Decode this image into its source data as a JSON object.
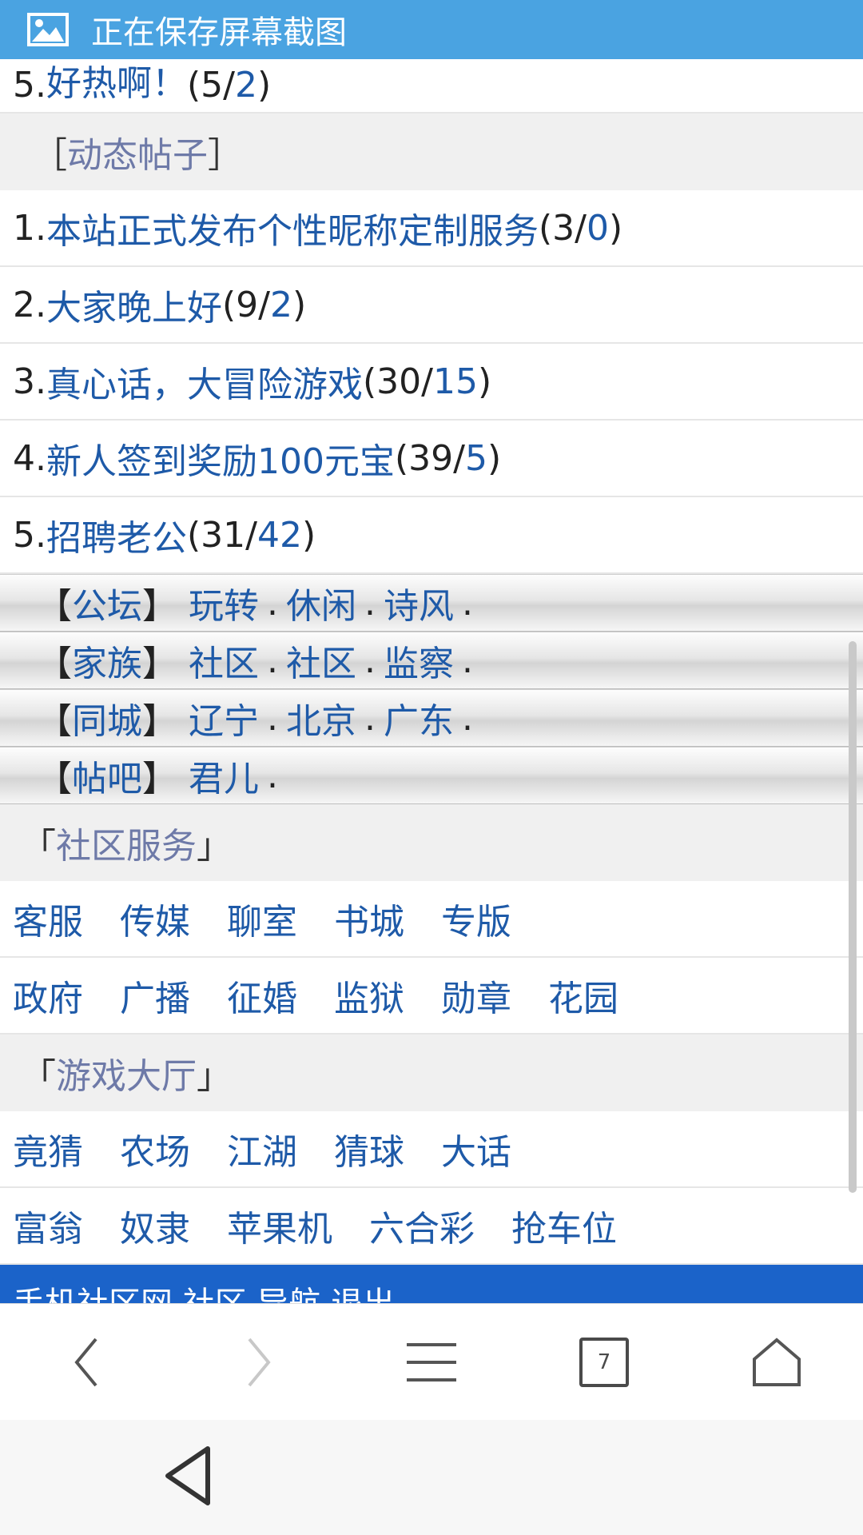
{
  "toast": {
    "icon": "image-icon",
    "text": "正在保存屏幕截图"
  },
  "top_partial_item": {
    "num": "5.",
    "title": "好热啊！",
    "count_a": "5",
    "count_b": "2"
  },
  "dynamic_posts": {
    "header": "动态帖子",
    "items": [
      {
        "num": "1.",
        "title": "本站正式发布个性昵称定制服务",
        "count_a": "3",
        "count_b": "0"
      },
      {
        "num": "2.",
        "title": "大家晚上好",
        "count_a": "9",
        "count_b": "2"
      },
      {
        "num": "3.",
        "title": "真心话，大冒险游戏",
        "count_a": "30",
        "count_b": "15"
      },
      {
        "num": "4.",
        "title": "新人签到奖励100元宝",
        "count_a": "39",
        "count_b": "5"
      },
      {
        "num": "5.",
        "title": "招聘老公",
        "count_a": "31",
        "count_b": "42"
      }
    ]
  },
  "forum_strips": [
    {
      "label": "公坛",
      "links": [
        "玩转",
        "休闲",
        "诗风"
      ]
    },
    {
      "label": "家族",
      "links": [
        "社区",
        "社区",
        "监察"
      ]
    },
    {
      "label": "同城",
      "links": [
        "辽宁",
        "北京",
        "广东"
      ]
    },
    {
      "label": "帖吧",
      "links": [
        "君儿"
      ]
    }
  ],
  "community_services": {
    "header": "社区服务",
    "rows": [
      [
        "客服",
        "传媒",
        "聊室",
        "书城",
        "专版"
      ],
      [
        "政府",
        "广播",
        "征婚",
        "监狱",
        "勋章",
        "花园"
      ]
    ]
  },
  "game_hall": {
    "header": "游戏大厅",
    "rows": [
      [
        "竟猜",
        "农场",
        "江湖",
        "猜球",
        "大话"
      ],
      [
        "富翁",
        "奴隶",
        "苹果机",
        "六合彩",
        "抢车位"
      ]
    ]
  },
  "footer_partial": "手机社区网 社区 导航 退出",
  "browser": {
    "tab_count": "7"
  }
}
